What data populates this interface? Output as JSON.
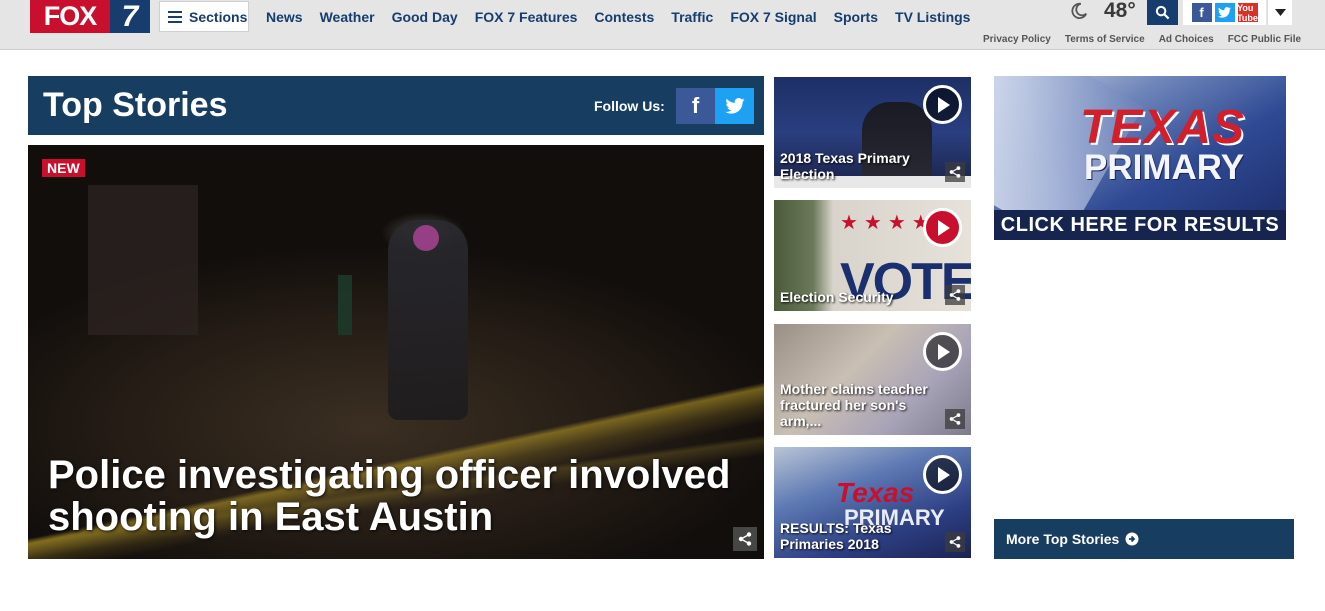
{
  "header": {
    "logo": {
      "brand": "FOX",
      "number": "7"
    },
    "sections_label": "Sections",
    "nav": [
      "News",
      "Weather",
      "Good Day",
      "FOX 7 Features",
      "Contests",
      "Traffic",
      "FOX 7 Signal",
      "Sports",
      "TV Listings"
    ],
    "weather": {
      "temperature": "48°",
      "icon": "moon-icon"
    },
    "social": {
      "facebook": "f",
      "twitter": "t",
      "youtube": "You Tube"
    },
    "util_links": [
      "Privacy Policy",
      "Terms of Service",
      "Ad Choices",
      "FCC Public File"
    ]
  },
  "top_stories": {
    "title": "Top Stories",
    "follow_label": "Follow Us:",
    "facebook_glyph": "f",
    "hero": {
      "badge": "NEW",
      "headline": "Police investigating officer involved shooting in East Austin"
    },
    "videos": [
      {
        "title": "2018 Texas Primary Election",
        "play_style": "dark"
      },
      {
        "title": "Election Security",
        "play_style": "red",
        "image_text": "VOTE",
        "stars": "★★★★"
      },
      {
        "title": "Mother claims teacher fractured her son's arm,...",
        "play_style": "dark"
      },
      {
        "title": "RESULTS: Texas Primaries 2018",
        "play_style": "dark",
        "image_texas": "Texas",
        "image_primary": "PRIMARY"
      }
    ]
  },
  "ad": {
    "line1": "TEXAS",
    "line2": "PRIMARY",
    "cta": "CLICK HERE FOR RESULTS"
  },
  "more_stories_label": "More Top Stories",
  "colors": {
    "brand_red": "#c8102e",
    "brand_navy": "#173d60",
    "header_bg": "#e5e5e5"
  }
}
